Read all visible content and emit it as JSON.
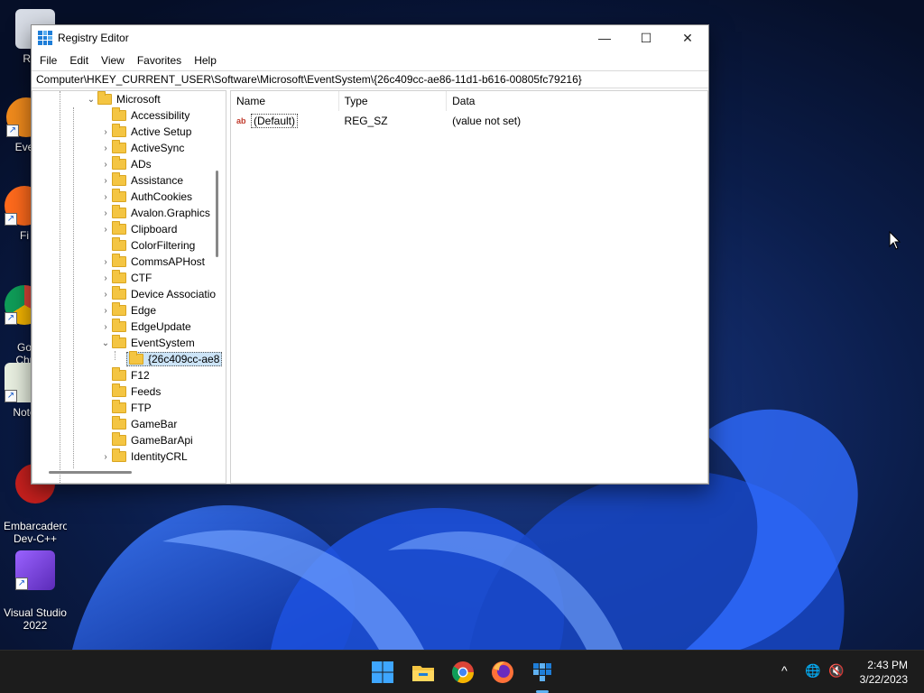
{
  "window": {
    "title": "Registry Editor",
    "minimize_glyph": "—",
    "maximize_glyph": "☐",
    "close_glyph": "✕"
  },
  "menu": [
    "File",
    "Edit",
    "View",
    "Favorites",
    "Help"
  ],
  "address": "Computer\\HKEY_CURRENT_USER\\Software\\Microsoft\\EventSystem\\{26c409cc-ae86-11d1-b616-00805fc79216}",
  "tree": {
    "items": [
      {
        "label": "Microsoft",
        "expander": "⌄",
        "depth": 0
      },
      {
        "label": "Accessibility",
        "expander": "",
        "depth": 1
      },
      {
        "label": "Active Setup",
        "expander": "›",
        "depth": 1
      },
      {
        "label": "ActiveSync",
        "expander": "›",
        "depth": 1
      },
      {
        "label": "ADs",
        "expander": "›",
        "depth": 1
      },
      {
        "label": "Assistance",
        "expander": "›",
        "depth": 1
      },
      {
        "label": "AuthCookies",
        "expander": "›",
        "depth": 1
      },
      {
        "label": "Avalon.Graphics",
        "expander": "›",
        "depth": 1
      },
      {
        "label": "Clipboard",
        "expander": "›",
        "depth": 1
      },
      {
        "label": "ColorFiltering",
        "expander": "",
        "depth": 1
      },
      {
        "label": "CommsAPHost",
        "expander": "›",
        "depth": 1
      },
      {
        "label": "CTF",
        "expander": "›",
        "depth": 1
      },
      {
        "label": "Device Associatio",
        "expander": "›",
        "depth": 1
      },
      {
        "label": "Edge",
        "expander": "›",
        "depth": 1
      },
      {
        "label": "EdgeUpdate",
        "expander": "›",
        "depth": 1
      },
      {
        "label": "EventSystem",
        "expander": "⌄",
        "depth": 1
      },
      {
        "label": "{26c409cc-ae8",
        "expander": "",
        "depth": 2,
        "selected": true
      },
      {
        "label": "F12",
        "expander": "",
        "depth": 1
      },
      {
        "label": "Feeds",
        "expander": "",
        "depth": 1
      },
      {
        "label": "FTP",
        "expander": "",
        "depth": 1
      },
      {
        "label": "GameBar",
        "expander": "",
        "depth": 1
      },
      {
        "label": "GameBarApi",
        "expander": "",
        "depth": 1
      },
      {
        "label": "IdentityCRL",
        "expander": "›",
        "depth": 1
      }
    ]
  },
  "list": {
    "columns": [
      "Name",
      "Type",
      "Data"
    ],
    "rows": [
      {
        "icon": "ab",
        "name": "(Default)",
        "type": "REG_SZ",
        "data": "(value not set)"
      }
    ]
  },
  "desktop_icons": [
    {
      "label": "Recy",
      "icon": "recycle-bin-icon"
    },
    {
      "label": "Ever",
      "icon": "everything-icon"
    },
    {
      "label": "Fi",
      "icon": "firefox-icon"
    },
    {
      "label": "Go\nChr",
      "icon": "chrome-icon"
    },
    {
      "label": "Note",
      "icon": "notepad-icon"
    },
    {
      "label": "Embarcadero\nDev-C++",
      "icon": "devcpp-icon"
    },
    {
      "label": "Visual Studio\n2022",
      "icon": "visual-studio-icon"
    }
  ],
  "taskbar": {
    "apps": [
      "windows-start-icon",
      "file-explorer-icon",
      "chrome-icon",
      "firefox-icon",
      "regedit-icon"
    ],
    "tray": {
      "chevron": "^",
      "network": "🌐",
      "volume": "🔇"
    },
    "time": "2:43 PM",
    "date": "3/22/2023"
  },
  "colors": {
    "accent": "#1f7ed8",
    "folder": "#f4c542",
    "selection": "#cce4f7",
    "taskbar": "#1c1c1c"
  }
}
